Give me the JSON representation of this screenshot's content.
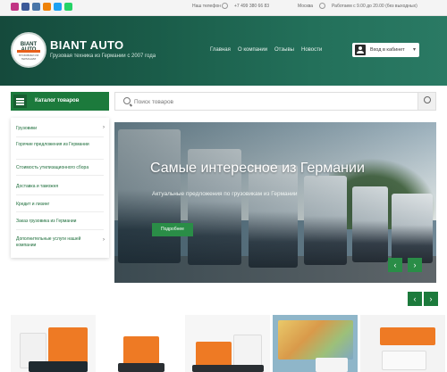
{
  "topbar": {
    "social": [
      {
        "name": "instagram-icon",
        "color": "#c13584"
      },
      {
        "name": "facebook-icon",
        "color": "#3b5998"
      },
      {
        "name": "vk-icon",
        "color": "#4a76a8"
      },
      {
        "name": "odnoklassniki-icon",
        "color": "#ee8208"
      },
      {
        "name": "twitter-icon",
        "color": "#1da1f2"
      },
      {
        "name": "whatsapp-icon",
        "color": "#25d366"
      }
    ],
    "lang_label": "Наш телефон",
    "phone": "+7 499 380 66 83",
    "schedule_label": "Москва",
    "schedule": "Работаем с 9.00 до 20.00 (без выходных)"
  },
  "header": {
    "logo_title": "BIANT AUTO",
    "logo_sub": "ГРУЗОВИКИ ИЗ ГЕРМАНИИ",
    "brand": "BIANT AUTO",
    "tagline": "Грузовая техника из Германии с 2007 года",
    "nav": [
      "Главная",
      "О компании",
      "Отзывы",
      "Новости"
    ],
    "login_label": "Вход в кабинет"
  },
  "catalog": {
    "label": "Каталог товаров"
  },
  "search": {
    "placeholder": "Поиск товаров"
  },
  "menu": {
    "items": [
      {
        "label": "Грузовики",
        "has_arrow": true
      },
      {
        "label": "Горячие предложения из Германии",
        "has_arrow": false
      },
      {
        "label": "Стоимость утилизационного сбора",
        "has_arrow": false
      },
      {
        "label": "Доставка и таможня",
        "has_arrow": false
      },
      {
        "label": "Кредит и лизинг",
        "has_arrow": false
      },
      {
        "label": "Заказ грузовика из Германии",
        "has_arrow": false
      },
      {
        "label": "Дополнительные услуги нашей компании",
        "has_arrow": true
      }
    ]
  },
  "hero": {
    "title": "Самые интересное из Германии",
    "subtitle": "Актуальные предложения по грузовикам из Германии",
    "button": "Подробнее"
  },
  "colors": {
    "brand_green": "#1c7a3c",
    "header_dark": "#154a3c",
    "accent_orange": "#e8601c"
  }
}
